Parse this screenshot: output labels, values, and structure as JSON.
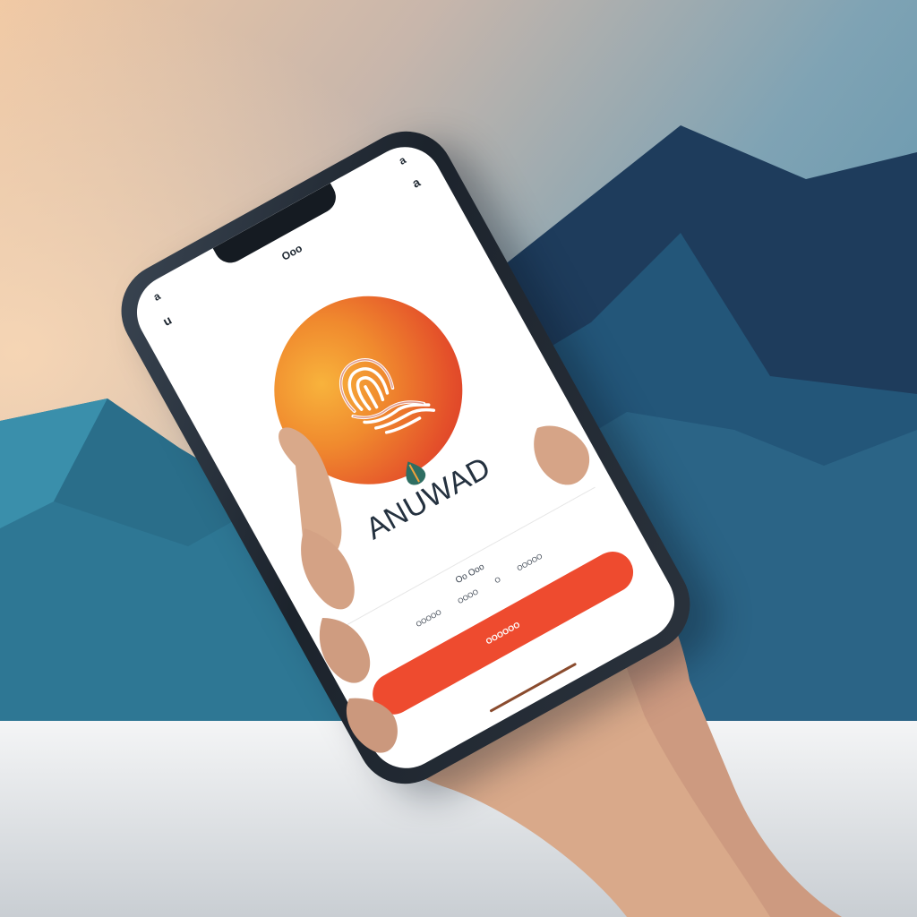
{
  "status_bar": {
    "time": "a",
    "signal": "a"
  },
  "top_bar": {
    "back_glyph": "u",
    "title": "Ooo",
    "menu_glyph": "a"
  },
  "brand": {
    "name": "ANUWAD"
  },
  "footer": {
    "subtitle": "Oo Ooo",
    "links": [
      "OOOOO",
      "OOOO",
      "O",
      "OOOOO"
    ],
    "cta_label": "OOOOOO"
  },
  "colors": {
    "accent": "#ee4b2f",
    "logo_gradient": [
      "#f8b33c",
      "#d52c25"
    ],
    "mountain_dark": "#1e3c5c",
    "mountain_mid": "#2b6486",
    "sky_top": "#5f94ad",
    "sky_warm": "#f1c9a4"
  },
  "icons": {
    "logo": "fingerprint-icon",
    "logo_drop": "leaf-drop-icon",
    "back": "back-icon",
    "menu": "menu-icon"
  }
}
